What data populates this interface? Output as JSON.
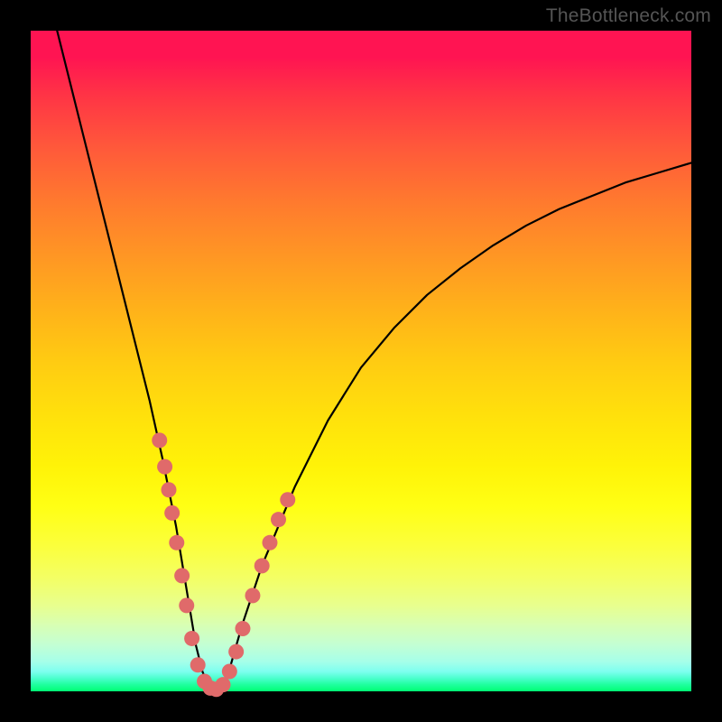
{
  "watermark": "TheBottleneck.com",
  "chart_data": {
    "type": "line",
    "title": "",
    "xlabel": "",
    "ylabel": "",
    "xlim": [
      0,
      100
    ],
    "ylim": [
      0,
      100
    ],
    "series": [
      {
        "name": "bottleneck-curve",
        "x": [
          4,
          6,
          8,
          10,
          12,
          14,
          16,
          18,
          20,
          21,
          22,
          23,
          24,
          25,
          26,
          27,
          28,
          29,
          30,
          32,
          35,
          40,
          45,
          50,
          55,
          60,
          65,
          70,
          75,
          80,
          85,
          90,
          95,
          100
        ],
        "values": [
          100,
          92,
          84,
          76,
          68,
          60,
          52,
          44,
          35,
          30,
          25,
          19,
          13,
          7,
          3,
          0.5,
          0,
          0.5,
          3,
          10,
          19,
          31,
          41,
          49,
          55,
          60,
          64,
          67.5,
          70.5,
          73,
          75,
          77,
          78.5,
          80
        ]
      }
    ],
    "markers": {
      "name": "highlight-dots",
      "color": "#e06a6a",
      "points": [
        {
          "x": 19.5,
          "y": 38
        },
        {
          "x": 20.3,
          "y": 34
        },
        {
          "x": 20.9,
          "y": 30.5
        },
        {
          "x": 21.4,
          "y": 27
        },
        {
          "x": 22.1,
          "y": 22.5
        },
        {
          "x": 22.9,
          "y": 17.5
        },
        {
          "x": 23.6,
          "y": 13
        },
        {
          "x": 24.4,
          "y": 8
        },
        {
          "x": 25.3,
          "y": 4
        },
        {
          "x": 26.3,
          "y": 1.5
        },
        {
          "x": 27.2,
          "y": 0.5
        },
        {
          "x": 28.1,
          "y": 0.3
        },
        {
          "x": 29.1,
          "y": 1
        },
        {
          "x": 30.1,
          "y": 3
        },
        {
          "x": 31.1,
          "y": 6
        },
        {
          "x": 32.1,
          "y": 9.5
        },
        {
          "x": 33.6,
          "y": 14.5
        },
        {
          "x": 35.0,
          "y": 19
        },
        {
          "x": 36.2,
          "y": 22.5
        },
        {
          "x": 37.5,
          "y": 26
        },
        {
          "x": 38.9,
          "y": 29
        }
      ]
    },
    "gradient_stops": [
      {
        "pos": 0,
        "color": "#ff1452"
      },
      {
        "pos": 50,
        "color": "#ffcb12"
      },
      {
        "pos": 75,
        "color": "#ffff14"
      },
      {
        "pos": 100,
        "color": "#00ff74"
      }
    ]
  }
}
